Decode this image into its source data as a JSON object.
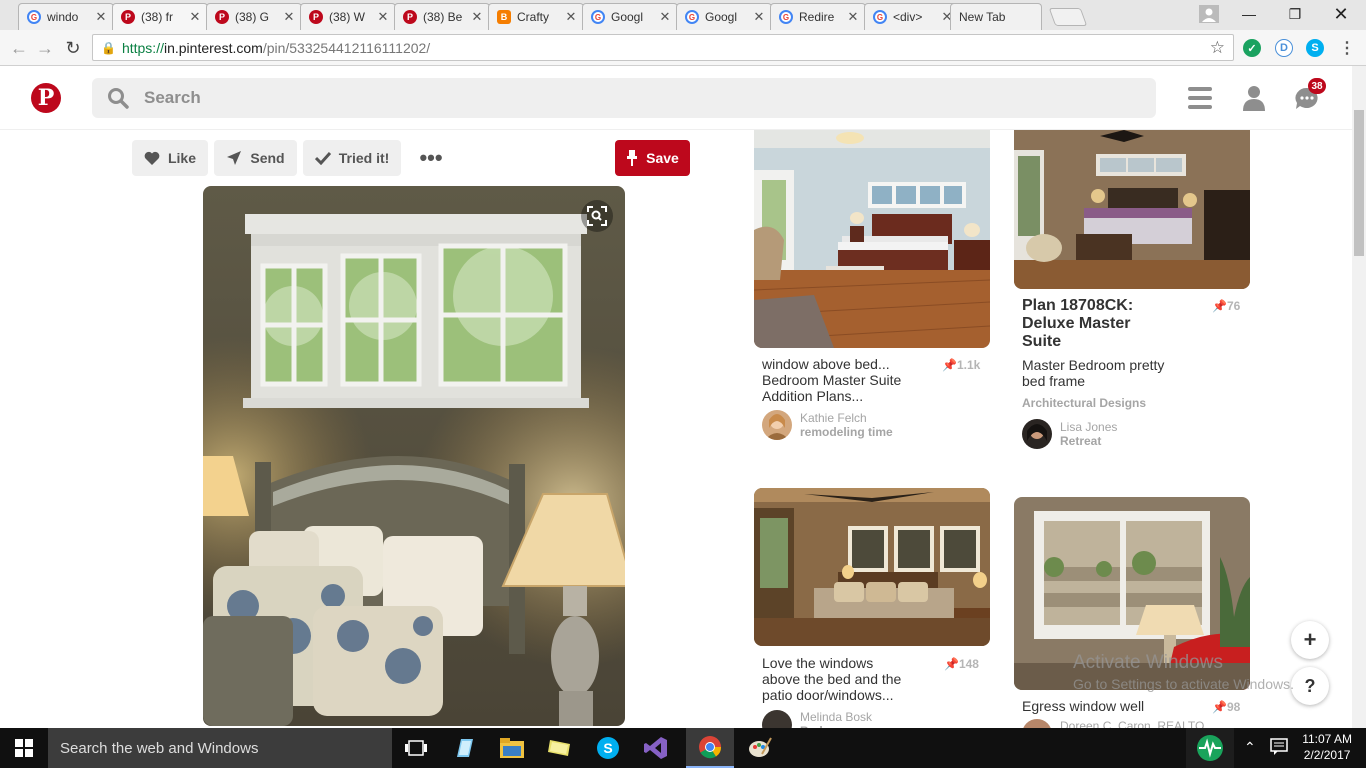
{
  "browser": {
    "tabs": [
      {
        "favicon": "google-icon",
        "title": "windo",
        "active": false
      },
      {
        "favicon": "pinterest-icon",
        "title": "(38) fr",
        "active": true
      },
      {
        "favicon": "pinterest-icon",
        "title": "(38) G",
        "active": false
      },
      {
        "favicon": "pinterest-icon",
        "title": "(38) W",
        "active": false
      },
      {
        "favicon": "pinterest-icon",
        "title": "(38) Be",
        "active": false
      },
      {
        "favicon": "blogger-icon",
        "title": "Crafty",
        "active": false
      },
      {
        "favicon": "google-icon",
        "title": "Googl",
        "active": false
      },
      {
        "favicon": "google-icon",
        "title": "Googl",
        "active": false
      },
      {
        "favicon": "google-icon",
        "title": "Redire",
        "active": false
      },
      {
        "favicon": "google-icon",
        "title": "<div>",
        "active": false
      },
      {
        "favicon": "none",
        "title": "New Tab",
        "active": false
      }
    ],
    "url_scheme": "https://",
    "url_host": "in.pinterest.com",
    "url_path": "/pin/533254412116111202/"
  },
  "header": {
    "search_placeholder": "Search",
    "notification_count": "38"
  },
  "pin_actions": {
    "like_label": "Like",
    "send_label": "Send",
    "tried_label": "Tried it!",
    "save_label": "Save"
  },
  "related_pins": [
    {
      "desc_line1": "window above bed...",
      "desc_line2": "Bedroom Master Suite",
      "desc_line3": "Addition Plans...",
      "saves": "1.1k",
      "user": "Kathie Felch",
      "board": "remodeling time"
    },
    {
      "title_line1": "Plan 18708CK:",
      "title_line2": "Deluxe Master",
      "title_line3": "Suite",
      "saves": "76",
      "desc_line1": "Master Bedroom pretty",
      "desc_line2": "bed frame",
      "source": "Architectural Designs",
      "user": "Lisa Jones",
      "board": "Retreat"
    },
    {
      "desc_line1": "Love the windows",
      "desc_line2": "above the bed and the",
      "desc_line3": "patio door/windows...",
      "saves": "148",
      "user": "Melinda Bosk",
      "board": "Bedroom"
    },
    {
      "desc_line1": "Egress window well",
      "saves": "98",
      "user": "Doreen C. Caron, REALTO"
    }
  ],
  "watermark": {
    "line1": "Activate Windows",
    "line2": "Go to Settings to activate Windows."
  },
  "taskbar": {
    "search_text": "Search the web and Windows",
    "time": "11:07 AM",
    "date": "2/2/2017"
  },
  "colors": {
    "pinterest_red": "#bd081c",
    "taskbar": "#101010"
  }
}
